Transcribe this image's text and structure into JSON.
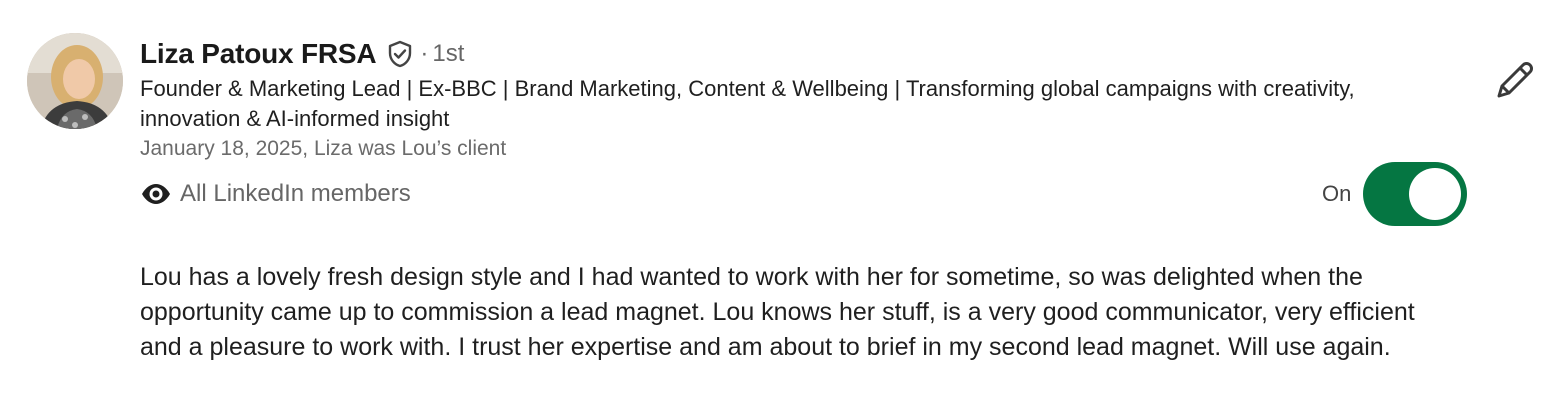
{
  "recommendation": {
    "author_name": "Liza Patoux FRSA",
    "degree_separator": "·",
    "degree": "1st",
    "headline": "Founder & Marketing Lead | Ex-BBC | Brand Marketing, Content & Wellbeing | Transforming global campaigns with creativity, innovation & AI-informed insight",
    "meta": "January 18, 2025, Liza was Lou’s client",
    "visibility_label": "All LinkedIn members",
    "toggle_label": "On",
    "toggle_on": true,
    "text": "Lou has a lovely fresh design style and I had wanted to work with her for sometime, so was delighted when the opportunity came up to commission a lead magnet. Lou knows her stuff, is a very good communicator, very efficient and a pleasure to work with. I trust her expertise and am about to brief in my second lead magnet. Will use again."
  },
  "icons": {
    "verified": "verified-shield-icon",
    "visibility": "eye-icon",
    "edit": "pencil-edit-icon"
  },
  "colors": {
    "toggle_on": "#057642",
    "secondary_text": "#666666",
    "primary_text": "#1f1f1f"
  }
}
